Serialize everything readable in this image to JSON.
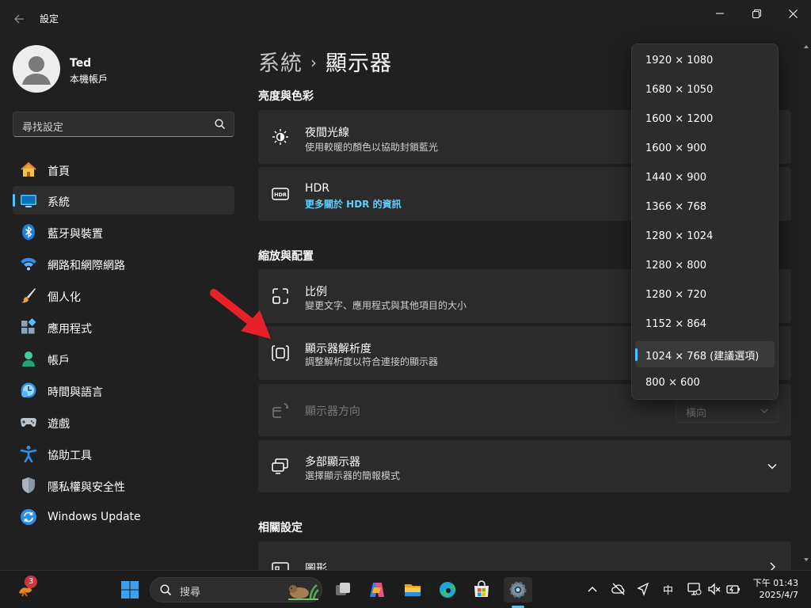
{
  "window": {
    "title": "設定"
  },
  "user": {
    "name": "Ted",
    "account_type": "本機帳戶"
  },
  "search": {
    "placeholder": "尋找設定"
  },
  "nav": [
    {
      "label": "首頁",
      "icon": "home-icon"
    },
    {
      "label": "系統",
      "icon": "system-icon",
      "active": true
    },
    {
      "label": "藍牙與裝置",
      "icon": "bluetooth-icon"
    },
    {
      "label": "網路和網際網路",
      "icon": "wifi-icon"
    },
    {
      "label": "個人化",
      "icon": "brush-icon"
    },
    {
      "label": "應用程式",
      "icon": "apps-icon"
    },
    {
      "label": "帳戶",
      "icon": "account-icon"
    },
    {
      "label": "時間與語言",
      "icon": "time-language-icon"
    },
    {
      "label": "遊戲",
      "icon": "gaming-icon"
    },
    {
      "label": "協助工具",
      "icon": "accessibility-icon"
    },
    {
      "label": "隱私權與安全性",
      "icon": "shield-icon"
    },
    {
      "label": "Windows Update",
      "icon": "windows-update-icon"
    }
  ],
  "breadcrumb": {
    "parent": "系統",
    "separator": "›",
    "current": "顯示器"
  },
  "sections": {
    "brightness_color": "亮度與色彩",
    "scale_layout": "縮放與配置",
    "related": "相關設定"
  },
  "cards": {
    "night_light": {
      "title": "夜間光線",
      "subtitle": "使用較暖的顏色以協助封鎖藍光"
    },
    "hdr": {
      "title": "HDR",
      "link": "更多關於 HDR 的資訊"
    },
    "scale": {
      "title": "比例",
      "subtitle": "變更文字、應用程式與其他項目的大小"
    },
    "resolution": {
      "title": "顯示器解析度",
      "subtitle": "調整解析度以符合連接的顯示器"
    },
    "orientation": {
      "title": "顯示器方向",
      "value": "橫向"
    },
    "multiple_displays": {
      "title": "多部顯示器",
      "subtitle": "選擇顯示器的簡報模式"
    },
    "graphics": {
      "title": "圖形"
    }
  },
  "resolution_menu": {
    "options": [
      "1920 × 1080",
      "1680 × 1050",
      "1600 × 1200",
      "1600 × 900",
      "1440 × 900",
      "1366 × 768",
      "1280 × 1024",
      "1280 × 800",
      "1280 × 720",
      "1152 × 864",
      "1024 × 768 (建議選項)",
      "800 × 600"
    ],
    "selected": "1024 × 768 (建議選項)"
  },
  "taskbar": {
    "search_text": "搜尋",
    "widgets_badge": "3",
    "tray_ime": "中",
    "clock_time": "下午 01:43",
    "clock_date": "2025/4/7"
  },
  "colors": {
    "accent": "#4cc2ff",
    "link": "#60cdff",
    "background": "#202020",
    "card": "#2b2b2b",
    "annotation_arrow": "#e8202a"
  }
}
